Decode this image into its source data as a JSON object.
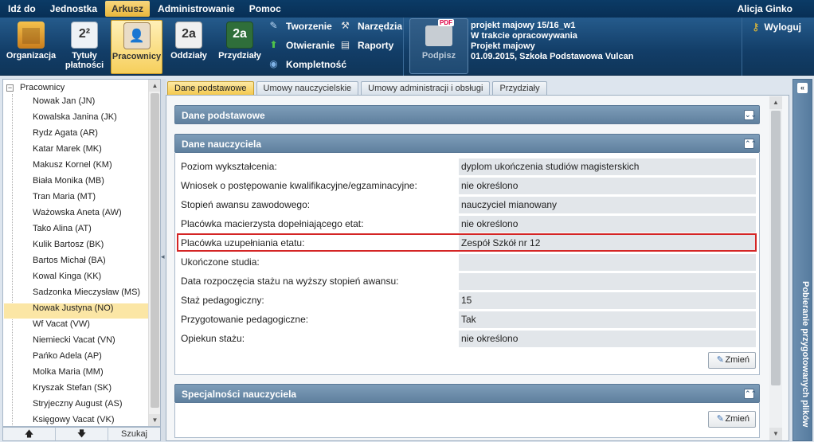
{
  "menubar": {
    "items": [
      "Idź do",
      "Jednostka",
      "Arkusz",
      "Administrowanie",
      "Pomoc"
    ],
    "user": "Alicja Ginko"
  },
  "ribbon": {
    "buttons": [
      {
        "label_1": "Organizacja",
        "label_2": ""
      },
      {
        "label_1": "Tytuły",
        "label_2": "płatności"
      },
      {
        "label_1": "Pracownicy",
        "label_2": ""
      },
      {
        "label_1": "Oddziały",
        "label_2": ""
      },
      {
        "label_1": "Przydziały",
        "label_2": ""
      }
    ],
    "small": {
      "tworzenie": "Tworzenie",
      "otwieranie": "Otwieranie",
      "kompletnosc": "Kompletność",
      "narzedzia": "Narzędzia",
      "raporty": "Raporty"
    },
    "podpisz": "Podpisz",
    "pdf_label": "PDF",
    "project": {
      "line1": "projekt majowy 15/16_w1",
      "line2": "W trakcie opracowywania",
      "line3": "Projekt majowy",
      "line4": "01.09.2015, Szkoła Podstawowa Vulcan"
    },
    "logout": "Wyloguj"
  },
  "tree": {
    "root": "Pracownicy",
    "items": [
      "Nowak Jan (JN)",
      "Kowalska Janina (JK)",
      "Rydz Agata (AR)",
      "Katar Marek (MK)",
      "Makusz Kornel (KM)",
      "Biała Monika (MB)",
      "Tran Maria (MT)",
      "Ważowska Aneta (AW)",
      "Tako Alina (AT)",
      "Kulik Bartosz (BK)",
      "Bartos Michał (BA)",
      "Kowal Kinga (KK)",
      "Sadzonka Mieczysław (MS)",
      "Nowak Justyna (NO)",
      "Wf Vacat (VW)",
      "Niemiecki Vacat (VN)",
      "Pańko Adela (AP)",
      "Molka Maria (MM)",
      "Kryszak Stefan (SK)",
      "Stryjeczny August (AS)",
      "Księgowy Vacat (VK)"
    ],
    "selected": "Nowak Justyna (NO)",
    "footer": {
      "up": "🡅",
      "down": "🡇",
      "search": "Szukaj"
    }
  },
  "tabs": [
    "Dane podstawowe",
    "Umowy nauczycielskie",
    "Umowy administracji i obsługi",
    "Przydziały"
  ],
  "active_tab": "Dane podstawowe",
  "sections": {
    "dane_podstawowe": "Dane podstawowe",
    "dane_nauczyciela": "Dane nauczyciela",
    "specjalnosci": "Specjalności nauczyciela"
  },
  "fields": [
    {
      "label": "Poziom wykształcenia:",
      "value": "dyplom ukończenia studiów magisterskich"
    },
    {
      "label": "Wniosek o postępowanie kwalifikacyjne/egzaminacyjne:",
      "value": "nie określono"
    },
    {
      "label": "Stopień awansu zawodowego:",
      "value": "nauczyciel mianowany"
    },
    {
      "label": "Placówka macierzysta dopełniającego etat:",
      "value": "nie określono"
    },
    {
      "label": "Placówka uzupełniania etatu:",
      "value": "Zespół Szkół nr 12"
    },
    {
      "label": "Ukończone studia:",
      "value": ""
    },
    {
      "label": "Data rozpoczęcia stażu na wyższy stopień awansu:",
      "value": ""
    },
    {
      "label": "Staż pedagogiczny:",
      "value": "15"
    },
    {
      "label": "Przygotowanie pedagogiczne:",
      "value": "Tak"
    },
    {
      "label": "Opiekun stażu:",
      "value": "nie określono"
    }
  ],
  "buttons": {
    "zmien": "Zmień"
  },
  "right_panel": {
    "label": "Pobieranie przygotowanych plików"
  },
  "colors": {
    "accent": "#f4c94f",
    "header": "#0b3b66",
    "highlight_border": "#d42525"
  }
}
